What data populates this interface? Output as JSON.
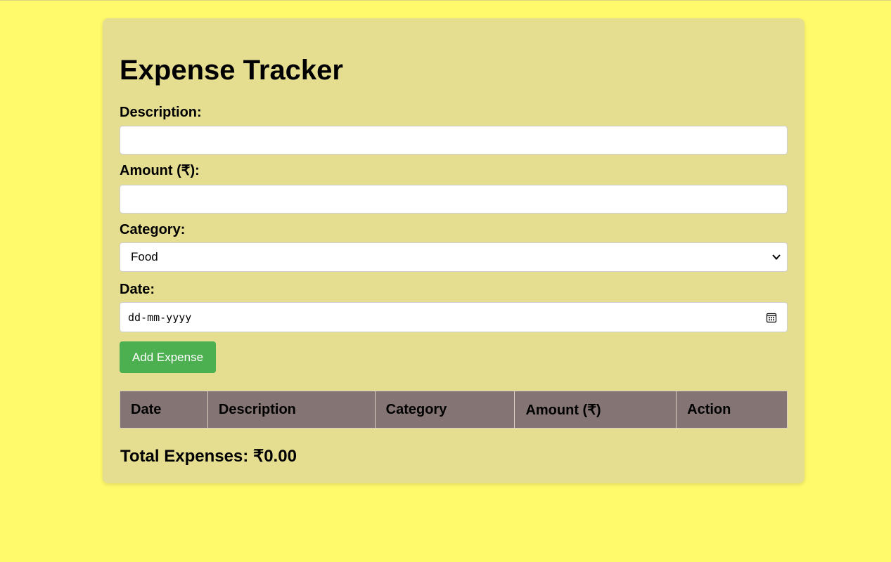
{
  "app": {
    "title": "Expense Tracker"
  },
  "form": {
    "description": {
      "label": "Description:",
      "value": ""
    },
    "amount": {
      "label": "Amount (₹):",
      "value": ""
    },
    "category": {
      "label": "Category:",
      "selected": "Food",
      "icon": "chevron-down-icon"
    },
    "date": {
      "label": "Date:",
      "placeholder": "dd-mm-yyyy",
      "icon": "calendar-icon"
    },
    "submit_label": "Add Expense"
  },
  "table": {
    "columns": [
      "Date",
      "Description",
      "Category",
      "Amount (₹)",
      "Action"
    ],
    "rows": []
  },
  "summary": {
    "total_label": "Total Expenses: ₹0.00"
  },
  "colors": {
    "page_background": "#fffa6b",
    "card_background": "#e5dd90",
    "button": "#4caf50",
    "table_header": "#857474"
  }
}
